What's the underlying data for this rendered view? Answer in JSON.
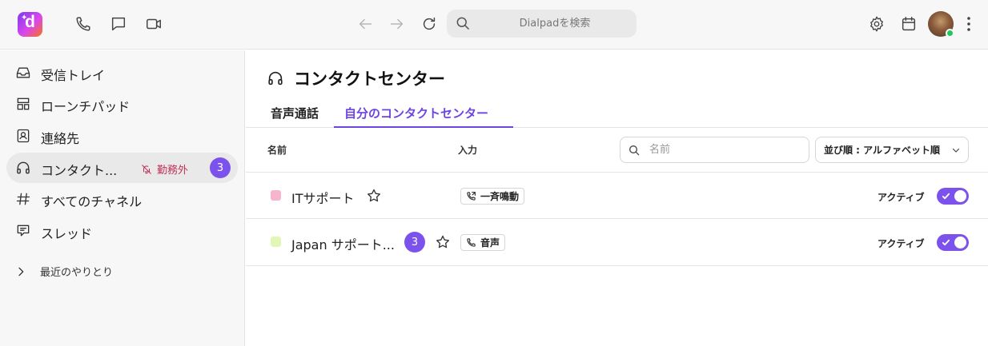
{
  "topbar": {
    "logo_letter": "d",
    "search_placeholder": "Dialpadを検索"
  },
  "sidebar": {
    "items": [
      {
        "label": "受信トレイ",
        "icon": "inbox-icon"
      },
      {
        "label": "ローンチパッド",
        "icon": "launchpad-icon"
      },
      {
        "label": "連絡先",
        "icon": "contacts-icon"
      },
      {
        "label": "コンタクト...",
        "icon": "headset-icon",
        "status": "勤務外",
        "badge": "3",
        "active": true
      },
      {
        "label": "すべてのチャネル",
        "icon": "hash-icon"
      },
      {
        "label": "スレッド",
        "icon": "threads-icon"
      }
    ],
    "recent_label": "最近のやりとり"
  },
  "main": {
    "title": "コンタクトセンター",
    "tabs": [
      {
        "label": "音声通話",
        "active": false
      },
      {
        "label": "自分のコンタクトセンター",
        "active": true
      }
    ],
    "columns": {
      "name": "名前",
      "input": "入力"
    },
    "filter_placeholder": "名前",
    "sort_label": "並び順 : アルファベット順",
    "rows": [
      {
        "name": "ITサポート",
        "color": "#f4b5cd",
        "input_label": "一斉鳴動",
        "input_icon": "phone-forward-icon",
        "status": "アクティブ",
        "active": true,
        "badge": null
      },
      {
        "name": "Japan サポート...",
        "color": "#e2f7b5",
        "input_label": "音声",
        "input_icon": "phone-icon",
        "status": "アクティブ",
        "active": true,
        "badge": "3"
      }
    ]
  },
  "colors": {
    "accent": "#7c52ec",
    "offduty": "#c2335a"
  }
}
